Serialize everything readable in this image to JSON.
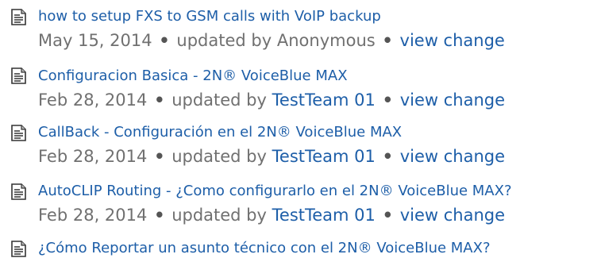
{
  "items": [
    {
      "title": "how to setup FXS to GSM calls with VoIP backup",
      "date": "May 15, 2014",
      "updated_by_label": "updated by",
      "author": "Anonymous",
      "author_is_link": false,
      "action": "view change"
    },
    {
      "title": "Configuracion Basica - 2N® VoiceBlue MAX",
      "date": "Feb 28, 2014",
      "updated_by_label": "updated by",
      "author": "TestTeam 01",
      "author_is_link": true,
      "action": "view change"
    },
    {
      "title": "CallBack - Configuración en el 2N® VoiceBlue MAX",
      "date": "Feb 28, 2014",
      "updated_by_label": "updated by",
      "author": "TestTeam 01",
      "author_is_link": true,
      "action": "view change"
    },
    {
      "title": "AutoCLIP Routing - ¿Como configurarlo en el 2N® VoiceBlue MAX?",
      "date": "Feb 28, 2014",
      "updated_by_label": "updated by",
      "author": "TestTeam 01",
      "author_is_link": true,
      "action": "view change"
    },
    {
      "title": "¿Cómo Reportar un asunto técnico con el 2N® VoiceBlue MAX?"
    }
  ],
  "separator": "•",
  "icon": "page-icon",
  "colors": {
    "link": "#1d5ea8",
    "meta_text": "#707070"
  }
}
